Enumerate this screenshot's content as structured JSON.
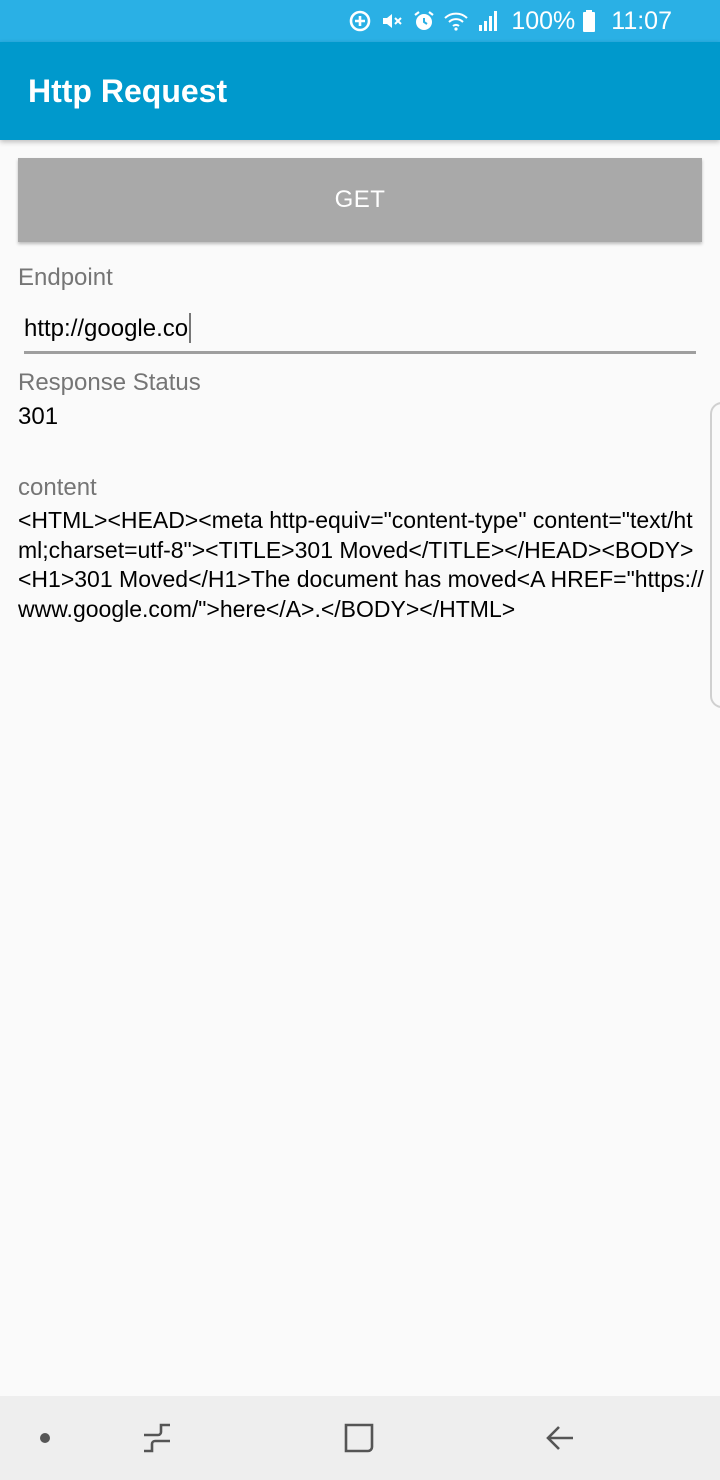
{
  "status_bar": {
    "battery": "100%",
    "time": "11:07",
    "icons": [
      "data-saver-icon",
      "mute-icon",
      "alarm-icon",
      "wifi-icon",
      "signal-icon",
      "battery-icon"
    ]
  },
  "app_bar": {
    "title": "Http Request"
  },
  "request": {
    "button_label": "GET",
    "endpoint_label": "Endpoint",
    "endpoint_value": "http://google.co"
  },
  "response": {
    "status_label": "Response Status",
    "status_value": "301",
    "content_label": "content",
    "content_value": "<HTML><HEAD><meta http-equiv=\"content-type\" content=\"text/html;charset=utf-8\"><TITLE>301 Moved</TITLE></HEAD><BODY><H1>301 Moved</H1>The document has moved<A HREF=\"https://www.google.com/\">here</A>.</BODY></HTML>"
  },
  "nav_bar": {
    "items": [
      "dot-icon",
      "recents-icon",
      "home-icon",
      "back-icon"
    ]
  },
  "colors": {
    "status_bar": "#2ab0e5",
    "app_bar": "#0099cc",
    "button": "#a9a9a9",
    "background": "#fafafa"
  }
}
